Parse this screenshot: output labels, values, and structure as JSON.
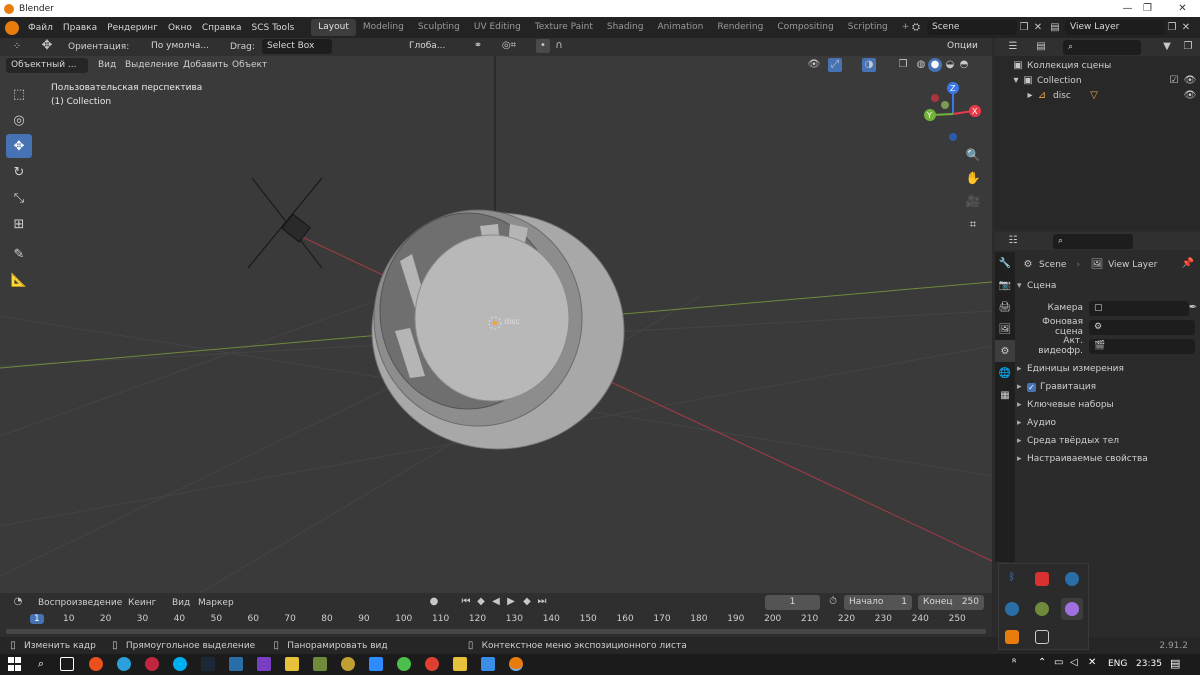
{
  "window": {
    "title": "Blender"
  },
  "menubar": {
    "menus": [
      "Файл",
      "Правка",
      "Рендеринг",
      "Окно",
      "Справка",
      "SCS Tools"
    ],
    "workspaces": [
      "Layout",
      "Modeling",
      "Sculpting",
      "UV Editing",
      "Texture Paint",
      "Shading",
      "Animation",
      "Rendering",
      "Compositing",
      "Scripting"
    ],
    "active_workspace": "Layout",
    "add_tab": "+",
    "scene": "Scene",
    "view_layer": "View Layer"
  },
  "viewport_header": {
    "orientation_label": "Ориентация:",
    "orientation_value": "По умолча...",
    "drag_label": "Drag:",
    "drag_value": "Select Box",
    "transform_value": "Глоба...",
    "options": "Опции",
    "mode": "Объектный ...",
    "menus": [
      "Вид",
      "Выделение",
      "Добавить",
      "Объект"
    ]
  },
  "viewport": {
    "perspective_label": "Пользовательская перспектива",
    "collection_label": "(1) Collection",
    "object_label": "disc",
    "gizmo": {
      "x": "X",
      "y": "Y",
      "z": "Z"
    }
  },
  "outliner": {
    "root": "Коллекция сцены",
    "collection": "Collection",
    "object": "disc"
  },
  "properties": {
    "breadcrumb_scene": "Scene",
    "breadcrumb_layer": "View Layer",
    "section": "Сцена",
    "camera_label": "Камера",
    "background_label": "Фоновая сцена",
    "clip_label": "Акт. видеофр.",
    "panels": [
      "Единицы измерения",
      "Гравитация",
      "Ключевые наборы",
      "Аудио",
      "Среда твёрдых тел",
      "Настраиваемые свойства"
    ],
    "gravity_checked": true
  },
  "timeline": {
    "menus": [
      "Воспроизведение",
      "Кеинг",
      "Вид",
      "Маркер"
    ],
    "current_frame": "1",
    "start_label": "Начало",
    "start_value": "1",
    "end_label": "Конец",
    "end_value": "250",
    "ruler": [
      "1",
      "10",
      "20",
      "30",
      "40",
      "50",
      "60",
      "70",
      "80",
      "90",
      "100",
      "110",
      "120",
      "130",
      "140",
      "150",
      "160",
      "170",
      "180",
      "190",
      "200",
      "210",
      "220",
      "230",
      "240",
      "250"
    ]
  },
  "statusbar": {
    "hint1": "Изменить кадр",
    "hint2": "Прямоугольное выделение",
    "hint3": "Панорамировать вид",
    "hint4": "Контекстное меню экспозиционного листа",
    "version": "2.91.2"
  },
  "taskbar": {
    "language": "ENG",
    "time": "23:35"
  },
  "colors": {
    "accent": "#4772b3",
    "x_axis": "#e83a4a",
    "y_axis": "#74b33a",
    "z_axis": "#3a78e8",
    "blender_orange": "#e87d0d"
  }
}
